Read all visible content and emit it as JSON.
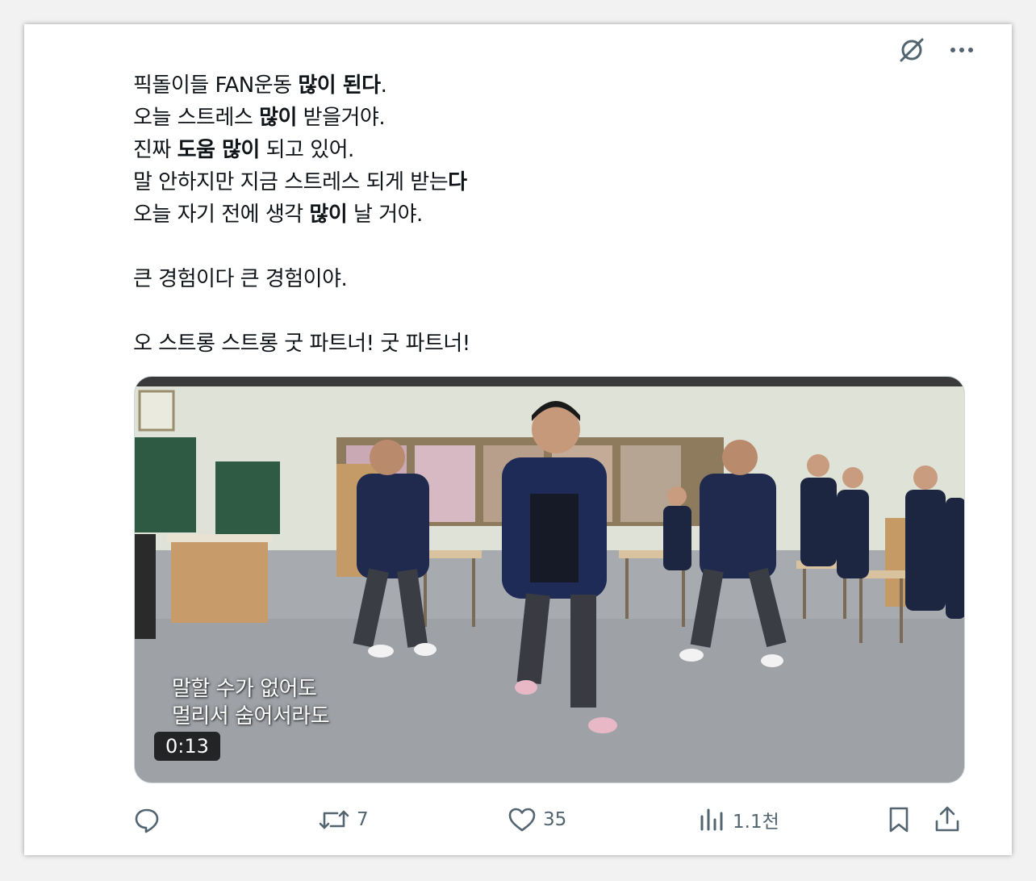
{
  "tweet": {
    "lines": [
      {
        "segments": [
          {
            "t": "픽돌이들 FAN운동 ",
            "b": false
          },
          {
            "t": "많이 된다",
            "b": true
          },
          {
            "t": ".",
            "b": false
          }
        ]
      },
      {
        "segments": [
          {
            "t": "오늘 스트레스 ",
            "b": false
          },
          {
            "t": "많이",
            "b": true
          },
          {
            "t": " 받을거야.",
            "b": false
          }
        ]
      },
      {
        "segments": [
          {
            "t": "진짜 ",
            "b": false
          },
          {
            "t": "도움 많이",
            "b": true
          },
          {
            "t": " 되고 있어.",
            "b": false
          }
        ]
      },
      {
        "segments": [
          {
            "t": "말 안하지만 지금 스트레스 되게 받는",
            "b": false
          },
          {
            "t": "다",
            "b": true
          }
        ]
      },
      {
        "segments": [
          {
            "t": "오늘 자기 전에 생각 ",
            "b": false
          },
          {
            "t": "많이",
            "b": true
          },
          {
            "t": " 날 거야.",
            "b": false
          }
        ]
      },
      {
        "segments": []
      },
      {
        "segments": [
          {
            "t": "큰 경험이다 큰 경험이야.",
            "b": false
          }
        ]
      },
      {
        "segments": []
      },
      {
        "segments": [
          {
            "t": "오 스트롱 스트롱 굿 파트너! 굿 파트너!",
            "b": false
          }
        ]
      }
    ]
  },
  "media": {
    "subtitle_line1": "말할 수가 없어도",
    "subtitle_line2": "멀리서 숨어서라도",
    "duration": "0:13"
  },
  "actions": {
    "reply_count": "",
    "retweet_count": "7",
    "like_count": "35",
    "views_count": "1.1천"
  },
  "icons": {
    "top": [
      "grok-slash-icon",
      "more-icon"
    ],
    "bottom": [
      "reply-icon",
      "retweet-icon",
      "like-icon",
      "views-icon",
      "bookmark-icon",
      "share-icon"
    ]
  },
  "colors": {
    "text": "#0f1419",
    "muted": "#536471"
  }
}
